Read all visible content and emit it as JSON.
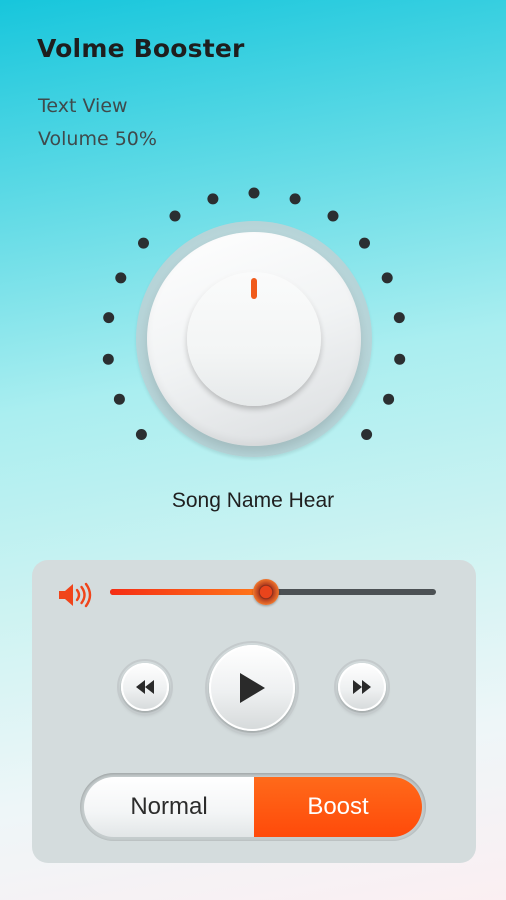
{
  "app": {
    "title": "Volme Booster"
  },
  "info": {
    "text_view": "Text View",
    "volume_label": "Volume 50%"
  },
  "volume": {
    "level": 0.5
  },
  "dial": {
    "dot_count": 17,
    "dot_color": "#2b2f31",
    "indicator_color": "#f05a1a"
  },
  "song": {
    "name": "Song Name Hear"
  },
  "player": {
    "slider_progress": 0.48,
    "rewind_icon": "rewind-icon",
    "play_icon": "play-icon",
    "forward_icon": "fast-forward-icon",
    "speaker_icon": "speaker-volume-icon"
  },
  "mode": {
    "normal_label": "Normal",
    "boost_label": "Boost",
    "selected": "Boost"
  },
  "colors": {
    "accent": "#ff5a10",
    "slider_active": "#f52d14",
    "slider_track": "#4c5154",
    "panel": "#d4dcdd"
  }
}
